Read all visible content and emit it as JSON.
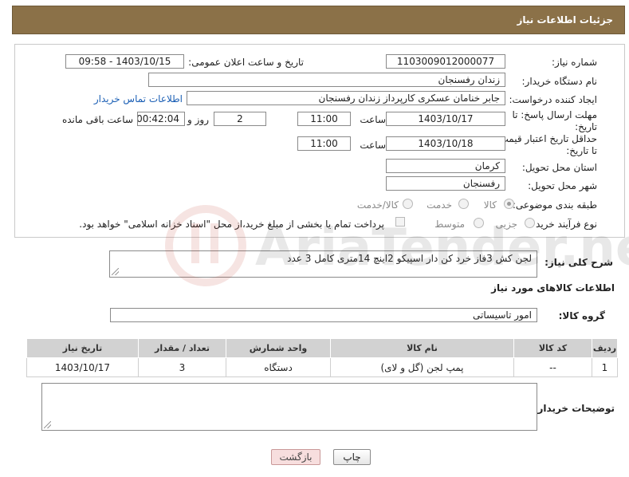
{
  "header": {
    "title": "جزئیات اطلاعات نیاز"
  },
  "form": {
    "need_number_label": "شماره نیاز:",
    "need_number": "1103009012000077",
    "announce_label": "تاریخ و ساعت اعلان عمومی:",
    "announce_value": "1403/10/15 - 09:58",
    "buyer_org_label": "نام دستگاه خریدار:",
    "buyer_org": "زندان رفسنجان",
    "creator_label": "ایجاد کننده درخواست:",
    "creator": "جابر خنامان عسکری کارپرداز زندان رفسنجان",
    "contact_link": "اطلاعات تماس خریدار",
    "reply_deadline_label": "مهلت ارسال پاسخ: تا تاریخ:",
    "reply_date": "1403/10/17",
    "time_label": "ساعت",
    "reply_time": "11:00",
    "days_value": "2",
    "days_label": "روز و",
    "remaining_time": "00:42:04",
    "remaining_label": "ساعت باقی مانده",
    "price_validity_label": "حداقل تاریخ اعتبار قیمت: تا تاریخ:",
    "price_date": "1403/10/18",
    "price_time": "11:00",
    "province_label": "استان محل تحویل:",
    "province": "کرمان",
    "city_label": "شهر محل تحویل:",
    "city": "رفسنجان",
    "category_label": "طبقه بندی موضوعی:",
    "category_options": [
      "کالا",
      "خدمت",
      "کالا/خدمت"
    ],
    "process_label": "نوع فرآیند خرید :",
    "process_options": [
      "جزیی",
      "متوسط"
    ],
    "payment_note": "پرداخت تمام یا بخشی از مبلغ خرید،از محل \"اسناد خزانه اسلامی\" خواهد بود."
  },
  "description": {
    "label": "شرح کلی نیاز:",
    "text": "لجن کش 3فاز خرد کن دار اسپیکو 2اینچ 14متری کامل 3 عدد"
  },
  "goods_section": {
    "title": "اطلاعات کالاهای مورد نیاز",
    "group_label": "گروه کالا:",
    "group_value": "امور تاسیساتی"
  },
  "table": {
    "headers": [
      "ردیف",
      "کد کالا",
      "نام کالا",
      "واحد شمارش",
      "تعداد / مقدار",
      "تاریخ نیاز"
    ],
    "rows": [
      [
        "1",
        "--",
        "پمپ لجن (گل و لای)",
        "دستگاه",
        "3",
        "1403/10/17"
      ]
    ]
  },
  "buyer_notes": {
    "label": "توضیحات خریدار:",
    "text": ""
  },
  "buttons": {
    "print": "چاپ",
    "back": "بازگشت"
  },
  "watermark": {
    "text": "AriaTender.neT"
  }
}
